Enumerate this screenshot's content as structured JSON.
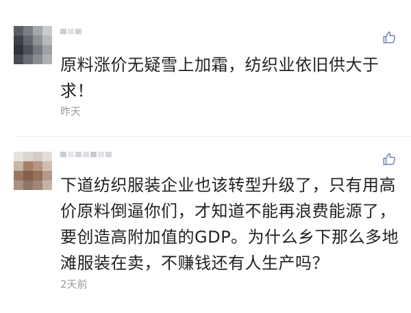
{
  "comments": [
    {
      "icon": "thumbs-up-icon",
      "text": "原料涨价无疑雪上加霜，纺织业依旧供大于求！",
      "time": "昨天"
    },
    {
      "icon": "thumbs-up-icon",
      "text": "下道纺织服装企业也该转型升级了，只有用高价原料倒逼你们，才知道不能再浪费能源了，要创造高附加值的GDP。为什么乡下那么多地滩服装在卖，不赚钱还有人生产吗？",
      "time": "2天前"
    }
  ],
  "colors": {
    "like_icon": "#6b7fb5",
    "text": "#222222",
    "timestamp": "#9a9a9a"
  }
}
